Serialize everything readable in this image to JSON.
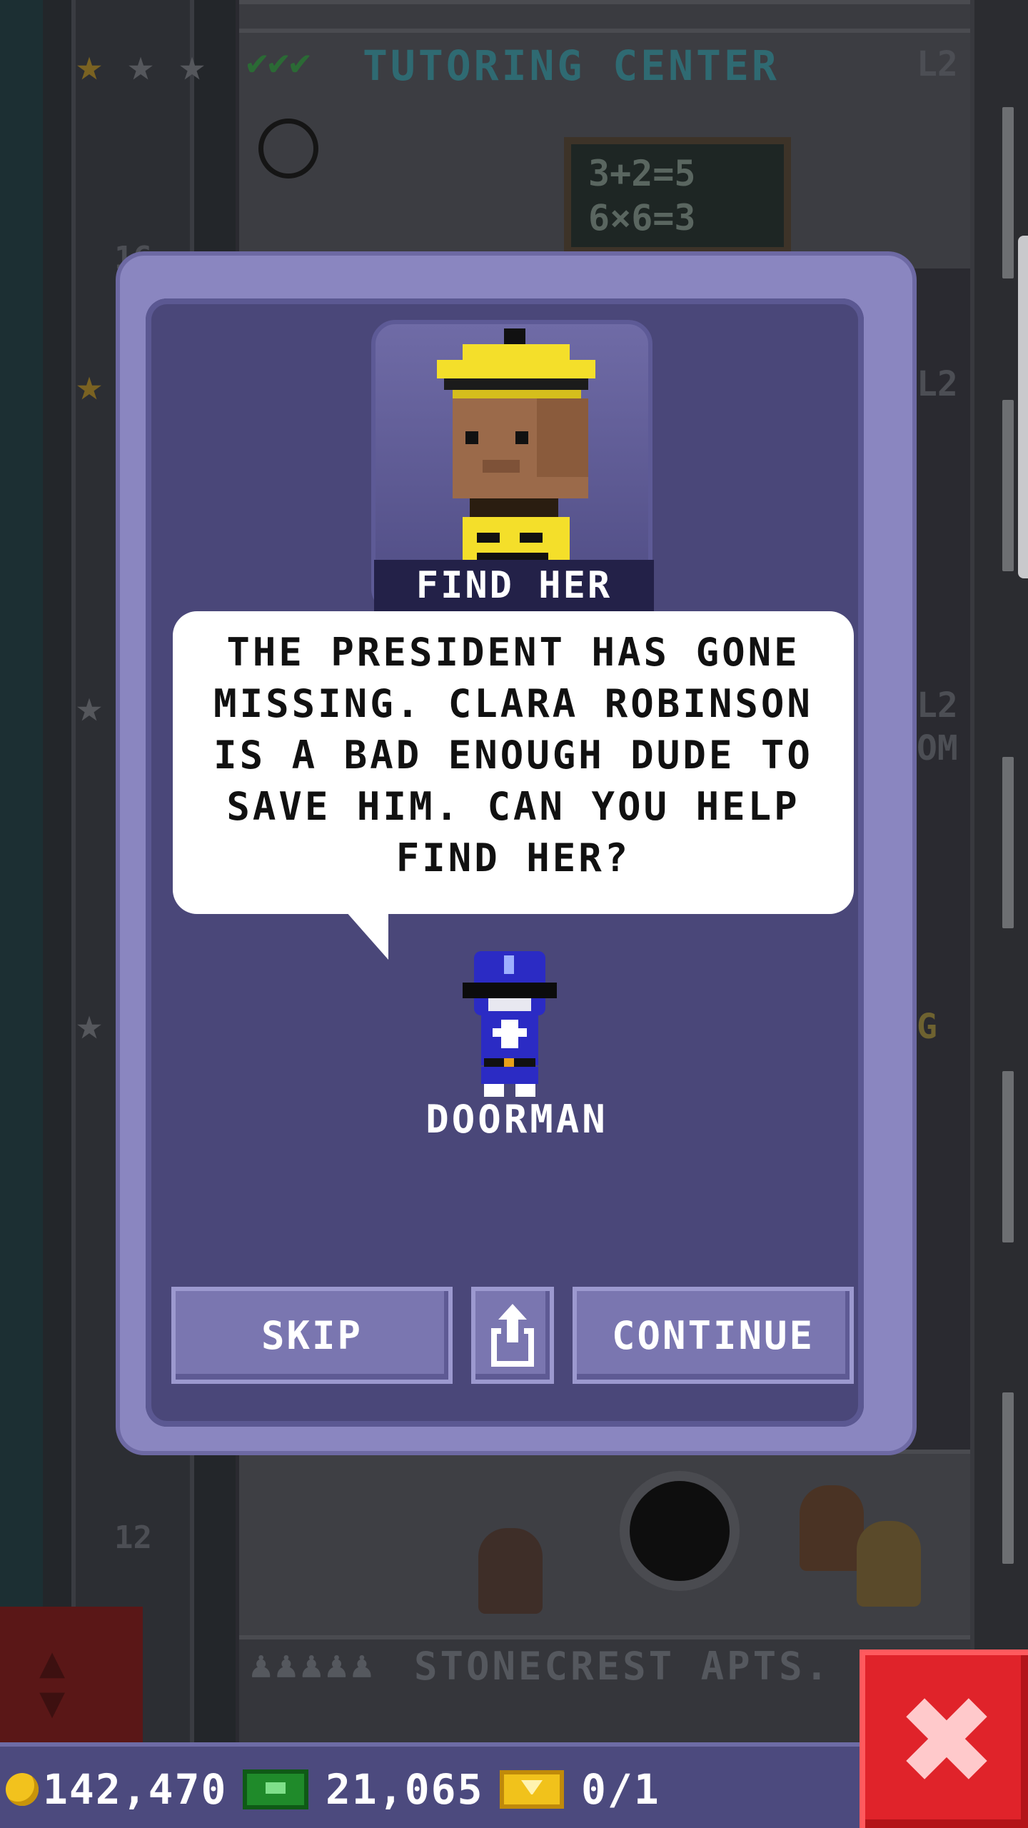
{
  "background": {
    "top_floor_name": "TUTORING CENTER",
    "top_floor_level": "L2",
    "chalkboard_lines": [
      "3+2=5",
      "6×6=3"
    ],
    "right_levels": [
      "L2",
      "L2"
    ],
    "right_fragments": [
      "OM",
      "G"
    ],
    "floor_numbers": [
      "16",
      "12"
    ],
    "bottom_floor_name": "STONECREST APTS."
  },
  "dialog": {
    "portrait_label": "FIND HER",
    "message": "THE PRESIDENT HAS GONE MISSING. CLARA ROBINSON IS A BAD ENOUGH DUDE TO SAVE HIM. CAN YOU HELP FIND HER?",
    "speaker_name": "DOORMAN",
    "skip_label": "SKIP",
    "continue_label": "CONTINUE",
    "share_icon": "share-icon"
  },
  "hud": {
    "coins": "142,470",
    "bux": "21,065",
    "tickets": "0/1"
  },
  "colors": {
    "dialog_frame": "#8a86c0",
    "dialog_inner": "#4a4779",
    "hud_bar": "#4c4a7e",
    "close_button": "#e0232a"
  }
}
